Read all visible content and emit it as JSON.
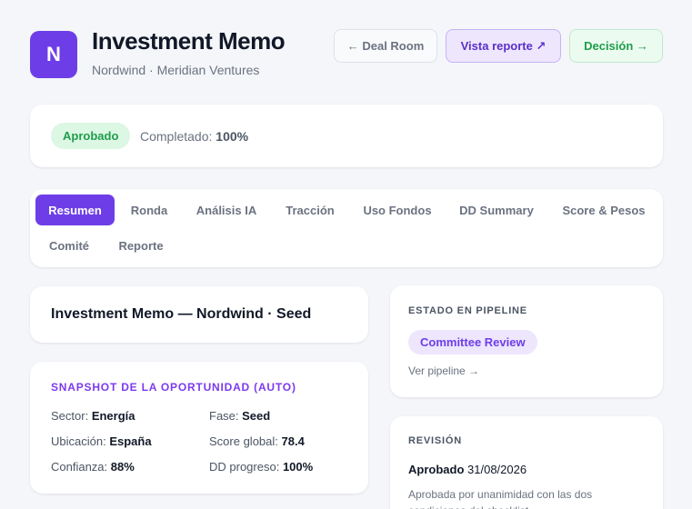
{
  "header": {
    "logo_letter": "N",
    "title": "Investment Memo",
    "subtitle": "Nordwind · Meridian Ventures",
    "buttons": {
      "deal_room": "← Deal Room",
      "report": "Vista reporte ↗",
      "decision": "Decisión →"
    }
  },
  "status": {
    "badge": "Aprobado",
    "completed_label": "Completado:",
    "completed_value": "100%"
  },
  "tabs": [
    {
      "label": "Resumen",
      "active": true
    },
    {
      "label": "Ronda"
    },
    {
      "label": "Análisis IA"
    },
    {
      "label": "Tracción"
    },
    {
      "label": "Uso Fondos"
    },
    {
      "label": "DD Summary"
    },
    {
      "label": "Score & Pesos"
    },
    {
      "label": "Comité"
    },
    {
      "label": "Reporte"
    }
  ],
  "memo": {
    "title": "Investment Memo — Nordwind · Seed"
  },
  "snapshot": {
    "heading": "SNAPSHOT DE LA OPORTUNIDAD (AUTO)",
    "items": [
      {
        "label": "Sector:",
        "value": "Energía"
      },
      {
        "label": "Fase:",
        "value": "Seed"
      },
      {
        "label": "Ubicación:",
        "value": "España"
      },
      {
        "label": "Score global:",
        "value": "78.4"
      },
      {
        "label": "Confianza:",
        "value": "88%"
      },
      {
        "label": "DD progreso:",
        "value": "100%"
      }
    ]
  },
  "pipeline": {
    "heading": "ESTADO EN PIPELINE",
    "stage": "Committee Review",
    "link": "Ver pipeline →"
  },
  "review": {
    "heading": "REVISIÓN",
    "status": "Aprobado",
    "date": "31/08/2026",
    "note": "Aprobada por unanimidad con las dos condiciones del checklist."
  }
}
